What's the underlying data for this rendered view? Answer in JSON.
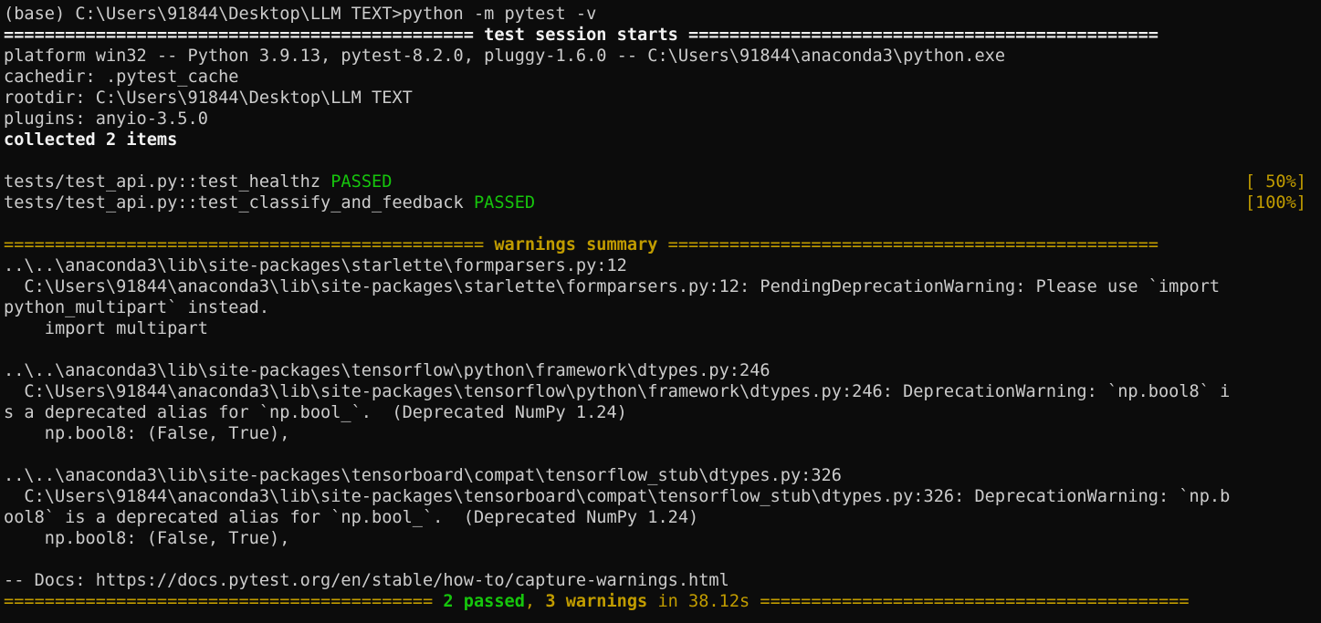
{
  "terminal": {
    "prompt": "(base) C:\\Users\\91844\\Desktop\\LLM TEXT>python -m pytest -v",
    "session_header_left": "============================================== ",
    "session_header_title": "test session starts",
    "session_header_right": " ==============================================",
    "platform": "platform win32 -- Python 3.9.13, pytest-8.2.0, pluggy-1.6.0 -- C:\\Users\\91844\\anaconda3\\python.exe",
    "cachedir": "cachedir: .pytest_cache",
    "rootdir": "rootdir: C:\\Users\\91844\\Desktop\\LLM TEXT",
    "plugins": "plugins: anyio-3.5.0",
    "collected": "collected 2 items",
    "results": [
      {
        "test": "tests/test_api.py::test_healthz ",
        "status": "PASSED",
        "progress": "[ 50%]"
      },
      {
        "test": "tests/test_api.py::test_classify_and_feedback ",
        "status": "PASSED",
        "progress": "[100%]"
      }
    ],
    "warnings_header_left": "=============================================== ",
    "warnings_header_title": "warnings summary",
    "warnings_header_right": " ================================================",
    "warnings": [
      {
        "location": "..\\..\\anaconda3\\lib\\site-packages\\starlette\\formparsers.py:12",
        "message_lines": [
          "  C:\\Users\\91844\\anaconda3\\lib\\site-packages\\starlette\\formparsers.py:12: PendingDeprecationWarning: Please use `import",
          "python_multipart` instead."
        ],
        "code": "    import multipart"
      },
      {
        "location": "..\\..\\anaconda3\\lib\\site-packages\\tensorflow\\python\\framework\\dtypes.py:246",
        "message_lines": [
          "  C:\\Users\\91844\\anaconda3\\lib\\site-packages\\tensorflow\\python\\framework\\dtypes.py:246: DeprecationWarning: `np.bool8` i",
          "s a deprecated alias for `np.bool_`.  (Deprecated NumPy 1.24)"
        ],
        "code": "    np.bool8: (False, True),"
      },
      {
        "location": "..\\..\\anaconda3\\lib\\site-packages\\tensorboard\\compat\\tensorflow_stub\\dtypes.py:326",
        "message_lines": [
          "  C:\\Users\\91844\\anaconda3\\lib\\site-packages\\tensorboard\\compat\\tensorflow_stub\\dtypes.py:326: DeprecationWarning: `np.b",
          "ool8` is a deprecated alias for `np.bool_`.  (Deprecated NumPy 1.24)"
        ],
        "code": "    np.bool8: (False, True),"
      }
    ],
    "docs": "-- Docs: https://docs.pytest.org/en/stable/how-to/capture-warnings.html",
    "summary": {
      "left": "========================================== ",
      "passed": "2 passed",
      "comma": ", ",
      "warnings": "3 warnings",
      "in_time": " in 38.12s ",
      "right": "=========================================="
    }
  },
  "colors": {
    "background": "#0c0c0c",
    "text": "#cccccc",
    "passed": "#16c60c",
    "warning": "#c19c00"
  }
}
